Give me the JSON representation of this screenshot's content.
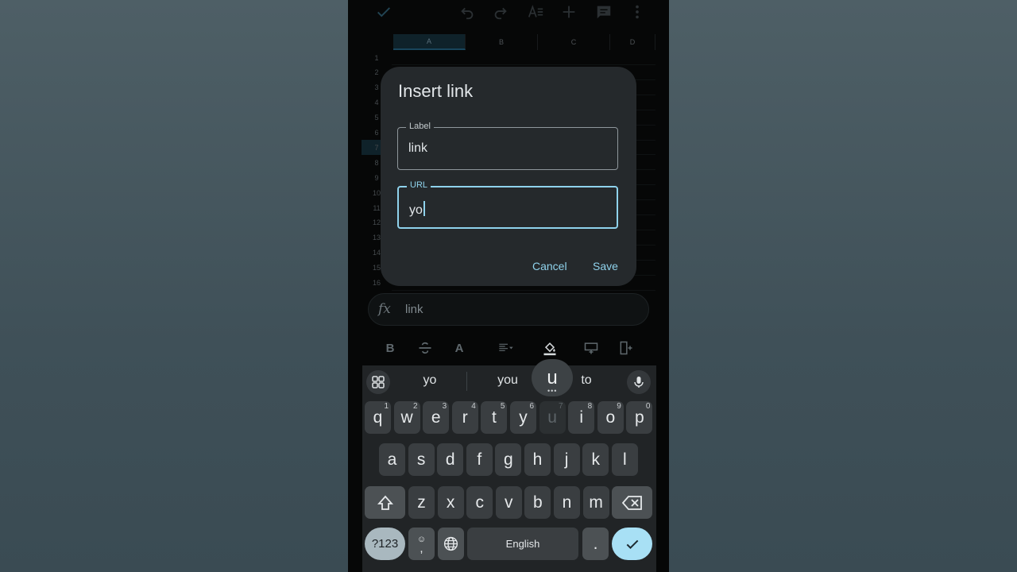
{
  "toolbar": {
    "icons": [
      "check-icon",
      "undo-icon",
      "redo-icon",
      "text-format-icon",
      "add-icon",
      "comment-icon",
      "more-vert-icon"
    ]
  },
  "sheet": {
    "columns": [
      "A",
      "B",
      "C",
      "D"
    ],
    "rows": [
      "1",
      "2",
      "3",
      "4",
      "5",
      "6",
      "7",
      "8",
      "9",
      "10",
      "11",
      "12",
      "13",
      "14",
      "15",
      "16"
    ],
    "selected_column": "A",
    "selected_row": "7"
  },
  "dialog": {
    "title": "Insert link",
    "label_field": {
      "label": "Label",
      "value": "link"
    },
    "url_field": {
      "label": "URL",
      "value": "yo"
    },
    "cancel": "Cancel",
    "save": "Save"
  },
  "formula_bar": {
    "fx": "fx",
    "value": "link"
  },
  "format_toolbar": {
    "icons": [
      "bold-icon",
      "strikethrough-icon",
      "text-color-icon",
      "align-icon",
      "fill-color-icon",
      "insert-row-icon",
      "insert-column-icon"
    ],
    "bold": "B",
    "text_color": "A"
  },
  "keyboard": {
    "suggestions": [
      "yo",
      "you",
      "to"
    ],
    "popup_key": "u",
    "row1": [
      {
        "k": "q",
        "h": "1"
      },
      {
        "k": "w",
        "h": "2"
      },
      {
        "k": "e",
        "h": "3"
      },
      {
        "k": "r",
        "h": "4"
      },
      {
        "k": "t",
        "h": "5"
      },
      {
        "k": "y",
        "h": "6"
      },
      {
        "k": "u",
        "h": "7"
      },
      {
        "k": "i",
        "h": "8"
      },
      {
        "k": "o",
        "h": "9"
      },
      {
        "k": "p",
        "h": "0"
      }
    ],
    "row2": [
      "a",
      "s",
      "d",
      "f",
      "g",
      "h",
      "j",
      "k",
      "l"
    ],
    "row3": [
      "z",
      "x",
      "c",
      "v",
      "b",
      "n",
      "m"
    ],
    "symbols": "?123",
    "emoji_comma": ",",
    "space": "English",
    "period": ".",
    "colors": {
      "accent": "#8fd2ec",
      "enter": "#a8e0f5"
    }
  }
}
